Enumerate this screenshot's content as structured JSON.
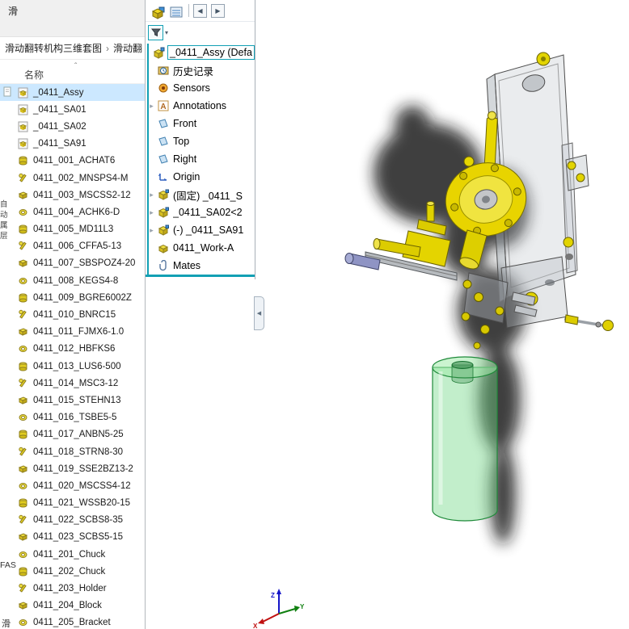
{
  "window": {
    "title_fragment": "滑"
  },
  "explorer": {
    "breadcrumb": {
      "segment1": "滑动翻转机构三维套图",
      "separator": "›",
      "segment2": "滑动翻"
    },
    "columns": {
      "name": "名称",
      "sort_indicator": "ˆ"
    },
    "files": [
      {
        "name": "_0411_Assy",
        "type": "assembly",
        "selected": true
      },
      {
        "name": "_0411_SA01",
        "type": "assembly"
      },
      {
        "name": "_0411_SA02",
        "type": "assembly"
      },
      {
        "name": "_0411_SA91",
        "type": "assembly"
      },
      {
        "name": "0411_001_ACHAT6",
        "type": "part"
      },
      {
        "name": "0411_002_MNSPS4-M",
        "type": "part"
      },
      {
        "name": "0411_003_MSCSS2-12",
        "type": "part"
      },
      {
        "name": "0411_004_ACHK6-D",
        "type": "part"
      },
      {
        "name": "0411_005_MD11L3",
        "type": "part"
      },
      {
        "name": "0411_006_CFFA5-13",
        "type": "part"
      },
      {
        "name": "0411_007_SBSPOZ4-20",
        "type": "part"
      },
      {
        "name": "0411_008_KEGS4-8",
        "type": "part"
      },
      {
        "name": "0411_009_BGRE6002Z",
        "type": "part"
      },
      {
        "name": "0411_010_BNRC15",
        "type": "part"
      },
      {
        "name": "0411_011_FJMX6-1.0",
        "type": "part"
      },
      {
        "name": "0411_012_HBFKS6",
        "type": "part"
      },
      {
        "name": "0411_013_LUS6-500",
        "type": "part"
      },
      {
        "name": "0411_014_MSC3-12",
        "type": "part"
      },
      {
        "name": "0411_015_STEHN13",
        "type": "part"
      },
      {
        "name": "0411_016_TSBE5-5",
        "type": "part"
      },
      {
        "name": "0411_017_ANBN5-25",
        "type": "part"
      },
      {
        "name": "0411_018_STRN8-30",
        "type": "part"
      },
      {
        "name": "0411_019_SSE2BZ13-2",
        "type": "part"
      },
      {
        "name": "0411_020_MSCSS4-12",
        "type": "part"
      },
      {
        "name": "0411_021_WSSB20-15",
        "type": "part"
      },
      {
        "name": "0411_022_SCBS8-35",
        "type": "part"
      },
      {
        "name": "0411_023_SCBS5-15",
        "type": "part"
      },
      {
        "name": "0411_201_Chuck",
        "type": "part"
      },
      {
        "name": "0411_202_Chuck",
        "type": "part"
      },
      {
        "name": "0411_203_Holder",
        "type": "part"
      },
      {
        "name": "0411_204_Block",
        "type": "part"
      },
      {
        "name": "0411_205_Bracket",
        "type": "part"
      }
    ],
    "edge_fragments": {
      "mid": [
        "自动",
        "属",
        "层"
      ],
      "bottom": "FAS",
      "corner": "滑"
    }
  },
  "feature_manager": {
    "toolbar": {
      "prev": "◀",
      "next": "▶"
    },
    "root": {
      "label": "_0411_Assy (Defa"
    },
    "expand_glyph": "▸",
    "collapse_tab_glyph": "◀",
    "items": [
      {
        "label": "历史记录",
        "icon": "history",
        "expandable": false
      },
      {
        "label": "Sensors",
        "icon": "sensors",
        "expandable": false
      },
      {
        "label": "Annotations",
        "icon": "annotations",
        "expandable": true
      },
      {
        "label": "Front",
        "icon": "plane",
        "expandable": false
      },
      {
        "label": "Top",
        "icon": "plane",
        "expandable": false
      },
      {
        "label": "Right",
        "icon": "plane",
        "expandable": false
      },
      {
        "label": "Origin",
        "icon": "origin",
        "expandable": false
      },
      {
        "label": "(固定) _0411_S",
        "icon": "component",
        "expandable": true
      },
      {
        "label": "_0411_SA02<2",
        "icon": "component",
        "expandable": true
      },
      {
        "label": "(-) _0411_SA91",
        "icon": "component",
        "expandable": true
      },
      {
        "label": "0411_Work-A",
        "icon": "part",
        "expandable": false
      },
      {
        "label": "Mates",
        "icon": "mates",
        "expandable": false
      }
    ]
  },
  "viewport": {
    "triad": {
      "x": "X",
      "y": "Y",
      "z": "Z"
    }
  },
  "colors": {
    "accent_teal": "#12a0b4",
    "selection_blue": "#cce8ff",
    "part_yellow": "#e8d400",
    "cylinder_green": "#6ed782"
  }
}
